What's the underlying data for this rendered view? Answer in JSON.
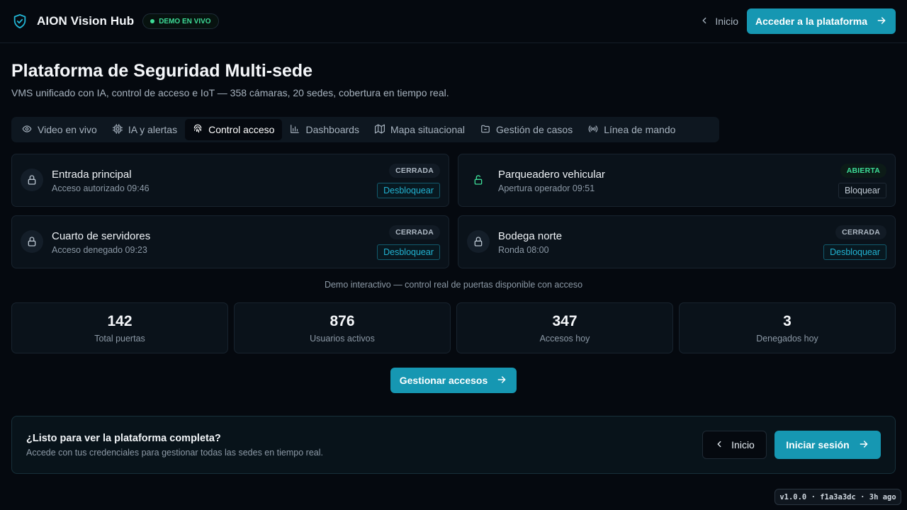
{
  "header": {
    "brand": "AION Vision Hub",
    "live_badge": "DEMO EN VIVO",
    "back_label": "Inicio",
    "cta_label": "Acceder a la plataforma"
  },
  "hero": {
    "title": "Plataforma de Seguridad Multi-sede",
    "subtitle": "VMS unificado con IA, control de acceso e IoT — 358 cámaras, 20 sedes, cobertura en tiempo real."
  },
  "tabs": [
    {
      "label": "Video en vivo",
      "icon": "eye-icon"
    },
    {
      "label": "IA y alertas",
      "icon": "cpu-icon"
    },
    {
      "label": "Control acceso",
      "icon": "fingerprint-icon",
      "active": true
    },
    {
      "label": "Dashboards",
      "icon": "bar-chart-icon"
    },
    {
      "label": "Mapa situacional",
      "icon": "map-icon"
    },
    {
      "label": "Gestión de casos",
      "icon": "folder-icon"
    },
    {
      "label": "Línea de mando",
      "icon": "radio-icon"
    }
  ],
  "doors": [
    {
      "name": "Entrada principal",
      "detail": "Acceso autorizado 09:46",
      "status": "CERRADA",
      "action": "Desbloquear",
      "locked": true
    },
    {
      "name": "Parqueadero vehicular",
      "detail": "Apertura operador 09:51",
      "status": "ABIERTA",
      "action": "Bloquear",
      "locked": false
    },
    {
      "name": "Cuarto de servidores",
      "detail": "Acceso denegado 09:23",
      "status": "CERRADA",
      "action": "Desbloquear",
      "locked": true
    },
    {
      "name": "Bodega norte",
      "detail": "Ronda 08:00",
      "status": "CERRADA",
      "action": "Desbloquear",
      "locked": true
    }
  ],
  "demo_note": "Demo interactivo — control real de puertas disponible con acceso",
  "stats": [
    {
      "value": "142",
      "label": "Total puertas"
    },
    {
      "value": "876",
      "label": "Usuarios activos"
    },
    {
      "value": "347",
      "label": "Accesos hoy"
    },
    {
      "value": "3",
      "label": "Denegados hoy"
    }
  ],
  "manage_label": "Gestionar accesos",
  "cta": {
    "heading": "¿Listo para ver la plataforma completa?",
    "text": "Accede con tus credenciales para gestionar todas las sedes en tiempo real.",
    "back_label": "Inicio",
    "login_label": "Iniciar sesión"
  },
  "version": "v1.0.0 · f1a3a3dc · 3h ago",
  "colors": {
    "accent": "#1697b2",
    "open": "#3ddc97",
    "background": "#05090f"
  }
}
